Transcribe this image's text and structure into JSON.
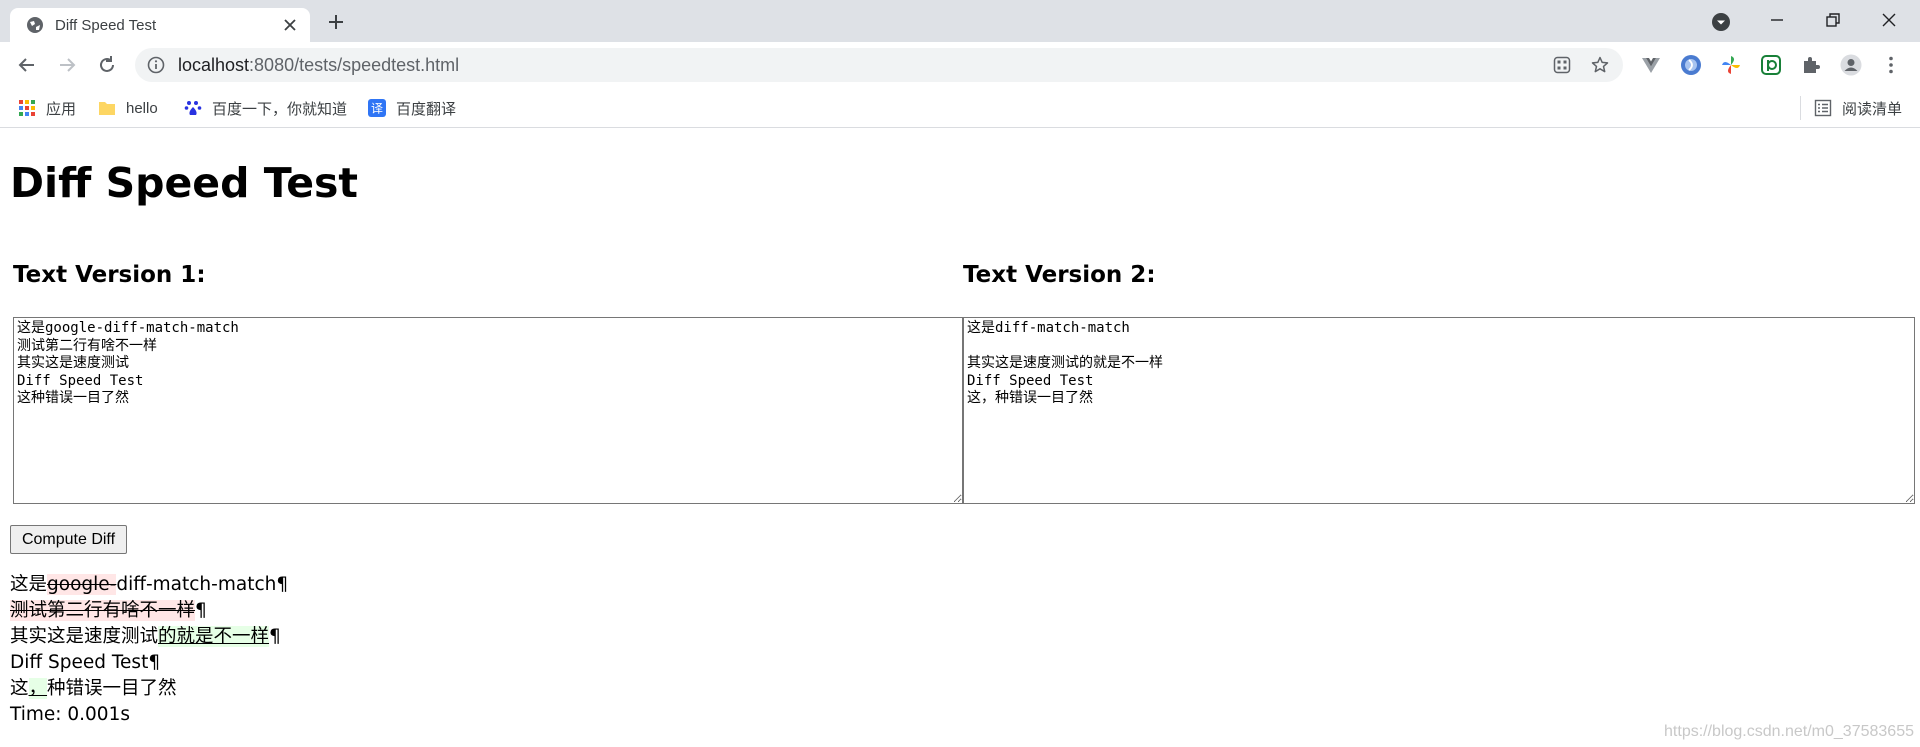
{
  "browser": {
    "tab_title": "Diff Speed Test",
    "url_host": "localhost",
    "url_path": ":8080/tests/speedtest.html",
    "bookmarks": [
      {
        "label": "应用",
        "icon": "apps-grid-icon"
      },
      {
        "label": "hello",
        "icon": "folder-icon"
      },
      {
        "label": "百度一下，你就知道",
        "icon": "baidu-paw-icon"
      },
      {
        "label": "百度翻译",
        "icon": "baidu-translate-icon"
      }
    ],
    "reading_list_label": "阅读清单",
    "translate_glyph": "译"
  },
  "page": {
    "title": "Diff Speed Test",
    "version1_heading": "Text Version 1:",
    "version2_heading": "Text Version 2:",
    "text1": "这是google-diff-match-match\n测试第二行有啥不一样\n其实这是速度测试\nDiff Speed Test\n这种错误一目了然",
    "text2": "这是diff-match-match\n\n其实这是速度测试的就是不一样\nDiff Speed Test\n这，种错误一目了然",
    "compute_button": "Compute Diff",
    "diff_lines": [
      [
        {
          "t": "equal",
          "s": "这是"
        },
        {
          "t": "delete",
          "s": "google-"
        },
        {
          "t": "equal",
          "s": "diff-match-match¶"
        }
      ],
      [
        {
          "t": "delete",
          "s": "测试第二行有啥不一样"
        },
        {
          "t": "equal",
          "s": "¶"
        }
      ],
      [
        {
          "t": "equal",
          "s": "其实这是速度测试"
        },
        {
          "t": "insert",
          "s": "的就是不一样"
        },
        {
          "t": "equal",
          "s": "¶"
        }
      ],
      [
        {
          "t": "equal",
          "s": "Diff Speed Test¶"
        }
      ],
      [
        {
          "t": "equal",
          "s": "这"
        },
        {
          "t": "insert",
          "s": "，"
        },
        {
          "t": "equal",
          "s": "种错误一目了然"
        }
      ]
    ],
    "time_text": "Time: 0.001s",
    "watermark": "https://blog.csdn.net/m0_37583655"
  },
  "colors": {
    "tabbar_bg": "#dee1e6",
    "omnibox_bg": "#f1f3f4",
    "diff_delete_bg": "#ffe6e6",
    "diff_insert_bg": "#e6ffe6"
  }
}
